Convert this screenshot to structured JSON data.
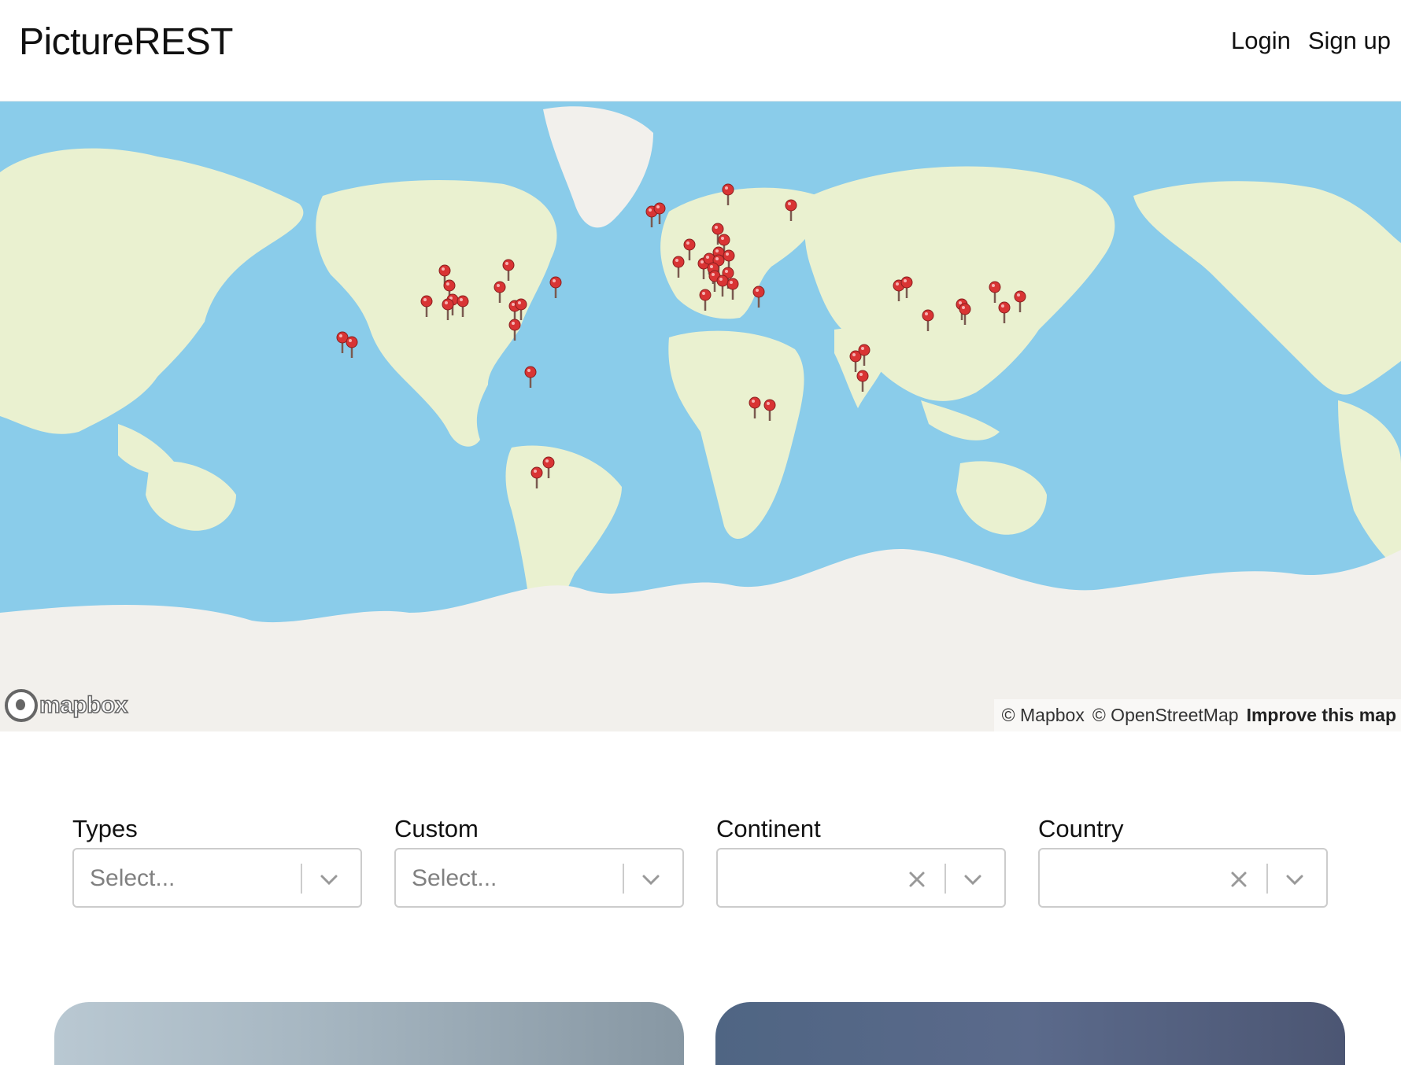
{
  "header": {
    "brand": "PictureREST",
    "login_label": "Login",
    "signup_label": "Sign up"
  },
  "map": {
    "logo_text": "mapbox",
    "attribution_mapbox": "© Mapbox",
    "attribution_osm": "© OpenStreetMap",
    "improve_label": "Improve this map",
    "colors": {
      "water": "#8accea",
      "land": "#eaf1d0",
      "ice": "#f2f0ec",
      "pin": "#d93434"
    }
  },
  "filters": [
    {
      "label": "Types",
      "placeholder": "Select...",
      "clearable": false
    },
    {
      "label": "Custom",
      "placeholder": "Select...",
      "clearable": false
    },
    {
      "label": "Continent",
      "placeholder": "",
      "clearable": true
    },
    {
      "label": "Country",
      "placeholder": "",
      "clearable": true
    }
  ]
}
